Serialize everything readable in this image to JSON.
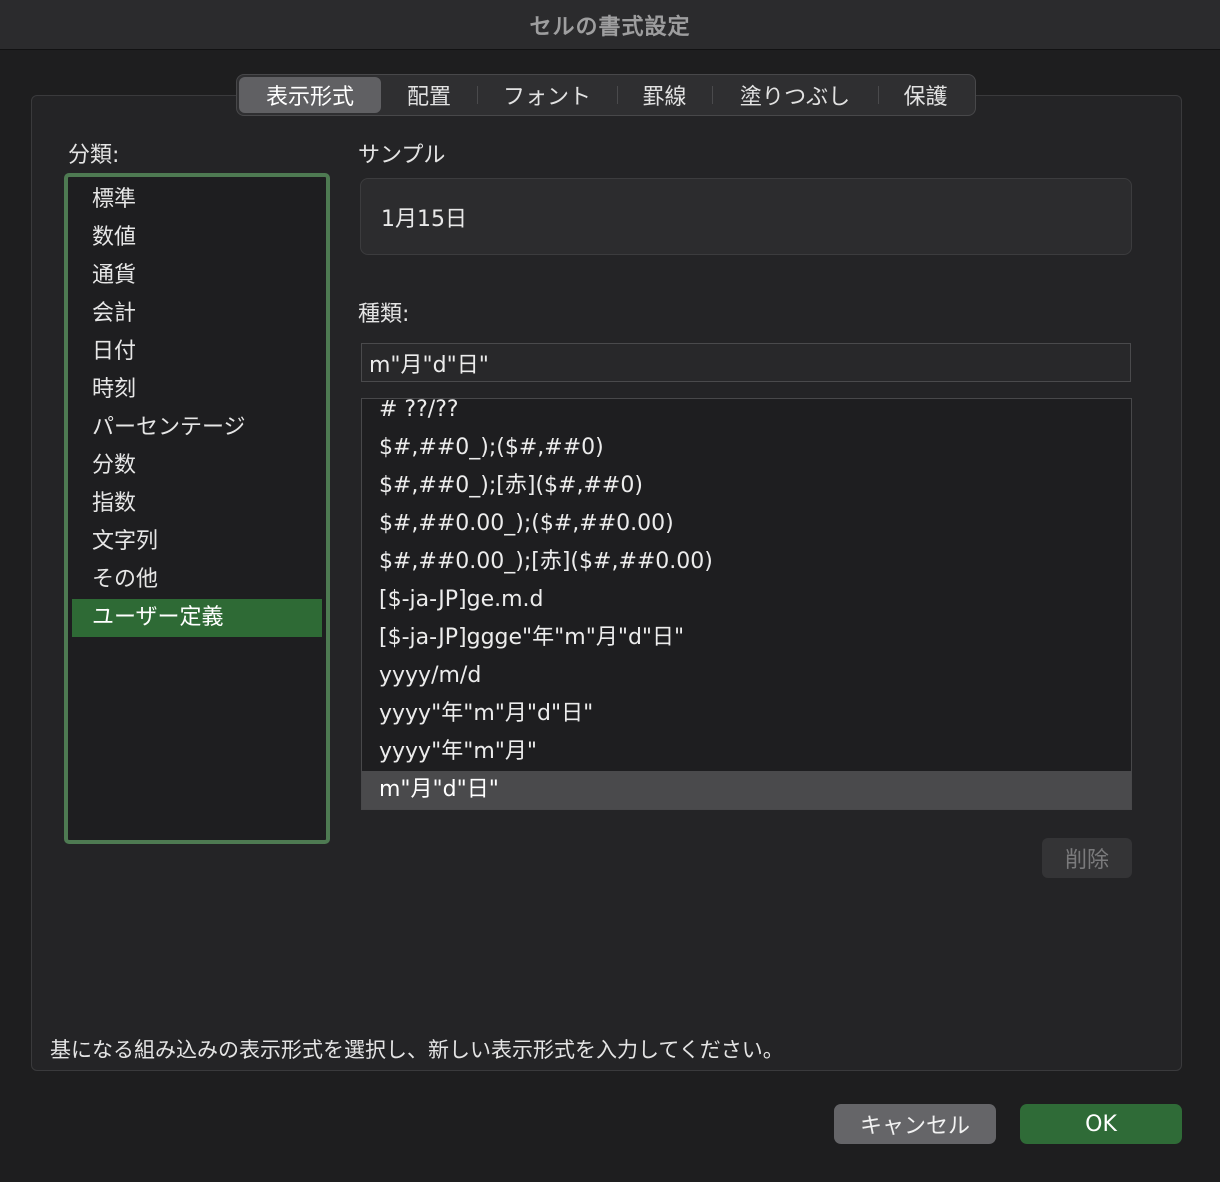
{
  "window": {
    "title": "セルの書式設定"
  },
  "tabs": [
    {
      "label": "表示形式",
      "active": true
    },
    {
      "label": "配置",
      "active": false
    },
    {
      "label": "フォント",
      "active": false
    },
    {
      "label": "罫線",
      "active": false
    },
    {
      "label": "塗りつぶし",
      "active": false
    },
    {
      "label": "保護",
      "active": false
    }
  ],
  "category": {
    "label": "分類:",
    "items": [
      "標準",
      "数値",
      "通貨",
      "会計",
      "日付",
      "時刻",
      "パーセンテージ",
      "分数",
      "指数",
      "文字列",
      "その他",
      "ユーザー定義"
    ],
    "selected": "ユーザー定義"
  },
  "sample": {
    "label": "サンプル",
    "value": "1月15日"
  },
  "type": {
    "label": "種類:",
    "value": "m\"月\"d\"日\"",
    "formats": [
      "# ??/??",
      "$#,##0_);($#,##0)",
      "$#,##0_);[赤]($#,##0)",
      "$#,##0.00_);($#,##0.00)",
      "$#,##0.00_);[赤]($#,##0.00)",
      "[$-ja-JP]ge.m.d",
      "[$-ja-JP]ggge\"年\"m\"月\"d\"日\"",
      "yyyy/m/d",
      "yyyy\"年\"m\"月\"d\"日\"",
      "yyyy\"年\"m\"月\"",
      "m\"月\"d\"日\""
    ],
    "selected": "m\"月\"d\"日\""
  },
  "buttons": {
    "delete": "削除",
    "cancel": "キャンセル",
    "ok": "OK"
  },
  "hint": "基になる組み込みの表示形式を選択し、新しい表示形式を入力してください。",
  "colors": {
    "accent_green": "#2e6a35",
    "list_border_green": "#4e7a52",
    "selected_gray": "#4a4a4c"
  }
}
